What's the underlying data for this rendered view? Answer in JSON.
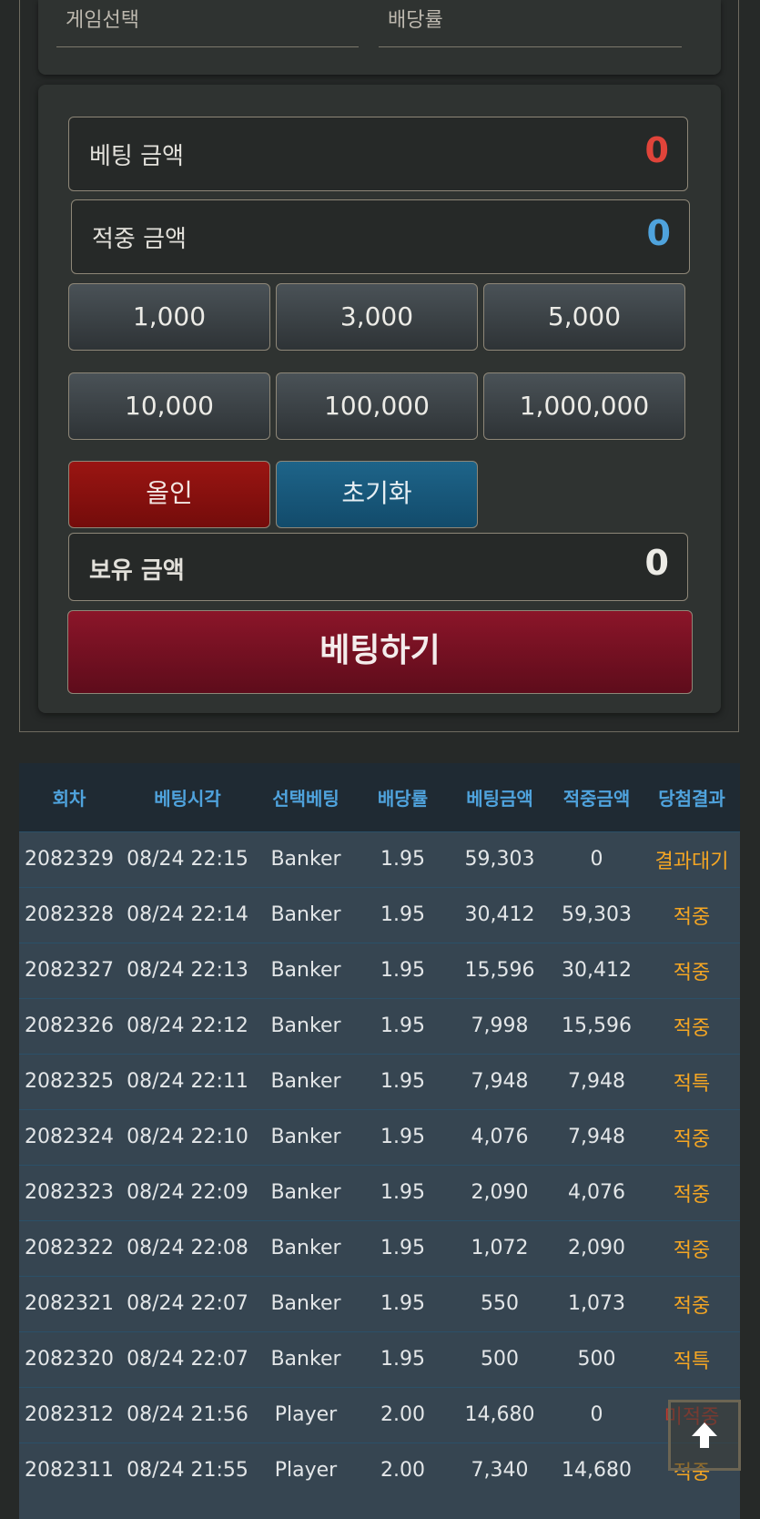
{
  "top": {
    "game_select_label": "게임선택",
    "odds_label": "배당률"
  },
  "bet_panel": {
    "bet_amount_label": "베팅 금액",
    "bet_amount_value": "0",
    "win_amount_label": "적중 금액",
    "win_amount_value": "0",
    "chips": [
      "1,000",
      "3,000",
      "5,000",
      "10,000",
      "100,000",
      "1,000,000"
    ],
    "allin_label": "올인",
    "reset_label": "초기화",
    "balance_label": "보유 금액",
    "balance_value": "0",
    "bet_button_label": "베팅하기",
    "colors": {
      "bet_value": "#e0443a",
      "win_value": "#4fa3dd",
      "balance_value": "#ecebe6"
    }
  },
  "history": {
    "headers": [
      "회차",
      "베팅시각",
      "선택베팅",
      "배당률",
      "베팅금액",
      "적중금액",
      "당첨결과"
    ],
    "rows": [
      [
        "2082329",
        "08/24 22:15",
        "Banker",
        "1.95",
        "59,303",
        "0",
        "결과대기"
      ],
      [
        "2082328",
        "08/24 22:14",
        "Banker",
        "1.95",
        "30,412",
        "59,303",
        "적중"
      ],
      [
        "2082327",
        "08/24 22:13",
        "Banker",
        "1.95",
        "15,596",
        "30,412",
        "적중"
      ],
      [
        "2082326",
        "08/24 22:12",
        "Banker",
        "1.95",
        "7,998",
        "15,596",
        "적중"
      ],
      [
        "2082325",
        "08/24 22:11",
        "Banker",
        "1.95",
        "7,948",
        "7,948",
        "적특"
      ],
      [
        "2082324",
        "08/24 22:10",
        "Banker",
        "1.95",
        "4,076",
        "7,948",
        "적중"
      ],
      [
        "2082323",
        "08/24 22:09",
        "Banker",
        "1.95",
        "2,090",
        "4,076",
        "적중"
      ],
      [
        "2082322",
        "08/24 22:08",
        "Banker",
        "1.95",
        "1,072",
        "2,090",
        "적중"
      ],
      [
        "2082321",
        "08/24 22:07",
        "Banker",
        "1.95",
        "550",
        "1,073",
        "적중"
      ],
      [
        "2082320",
        "08/24 22:07",
        "Banker",
        "1.95",
        "500",
        "500",
        "적특"
      ],
      [
        "2082312",
        "08/24 21:56",
        "Player",
        "2.00",
        "14,680",
        "0",
        "미적중"
      ],
      [
        "2082311",
        "08/24 21:55",
        "Player",
        "2.00",
        "7,340",
        "14,680",
        "적중"
      ]
    ],
    "result_colors": {
      "pending": "#f5a623",
      "hit": "#f5a623",
      "miss": "#c0392b"
    }
  },
  "scroll_top_icon": "arrow-up-icon"
}
